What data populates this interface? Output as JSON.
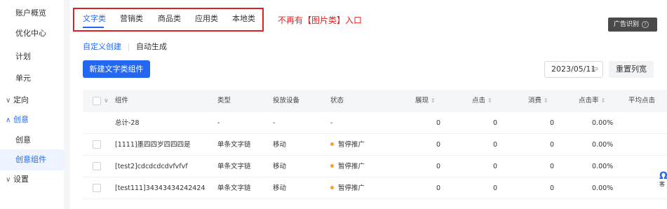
{
  "sidebar": {
    "items": [
      {
        "label": "账户概览"
      },
      {
        "label": "优化中心"
      },
      {
        "label": "计划"
      },
      {
        "label": "单元"
      },
      {
        "label": "定向",
        "chevron": "∨"
      },
      {
        "label": "创意",
        "chevron": "∧"
      },
      {
        "label": "创意"
      },
      {
        "label": "创意组件"
      },
      {
        "label": "设置",
        "chevron": "∨"
      }
    ]
  },
  "tabs": [
    {
      "label": "文字类"
    },
    {
      "label": "营销类"
    },
    {
      "label": "商品类"
    },
    {
      "label": "应用类"
    },
    {
      "label": "本地类"
    }
  ],
  "annotation": "不再有【图片类】入口",
  "report_button": {
    "label": "广告识别",
    "help": "?"
  },
  "subtabs": [
    {
      "label": "自定义创建"
    },
    {
      "label": "自动生成"
    }
  ],
  "new_button": "新建文字类组件",
  "date": {
    "value": "2023/05/11",
    "icon": "calendar-icon"
  },
  "reset_button": "重置列宽",
  "table": {
    "headers": {
      "component": "组件",
      "type": "类型",
      "device": "投放设备",
      "status": "状态",
      "impressions": "展现",
      "clicks": "点击",
      "spend": "消费",
      "ctr": "点击率",
      "avg": "平均点击"
    },
    "total": {
      "component": "总计-28",
      "type": "-",
      "device": "-",
      "status": "-",
      "impressions": "0",
      "clicks": "0",
      "spend": "0",
      "ctr": "0.00%"
    },
    "rows": [
      {
        "component": "[1111]墨四四岁四四四是",
        "type": "单条文字链",
        "device": "移动",
        "status": "暂停推广",
        "impressions": "0",
        "clicks": "0",
        "spend": "0",
        "ctr": "0.00%"
      },
      {
        "component": "[test2]cdcdcdcdvfvfvf",
        "type": "单条文字链",
        "device": "移动",
        "status": "暂停推广",
        "impressions": "0",
        "clicks": "0",
        "spend": "0",
        "ctr": "0.00%"
      },
      {
        "component": "[test111]34343434242424",
        "type": "单条文字链",
        "device": "移动",
        "status": "暂停推广",
        "impressions": "0",
        "clicks": "0",
        "spend": "0",
        "ctr": "0.00%"
      }
    ]
  },
  "float_help": {
    "mark": "Ω",
    "label": "客"
  },
  "colors": {
    "accent": "#2468f2",
    "annotation": "#e02020",
    "status_paused": "#ff9f1a"
  }
}
